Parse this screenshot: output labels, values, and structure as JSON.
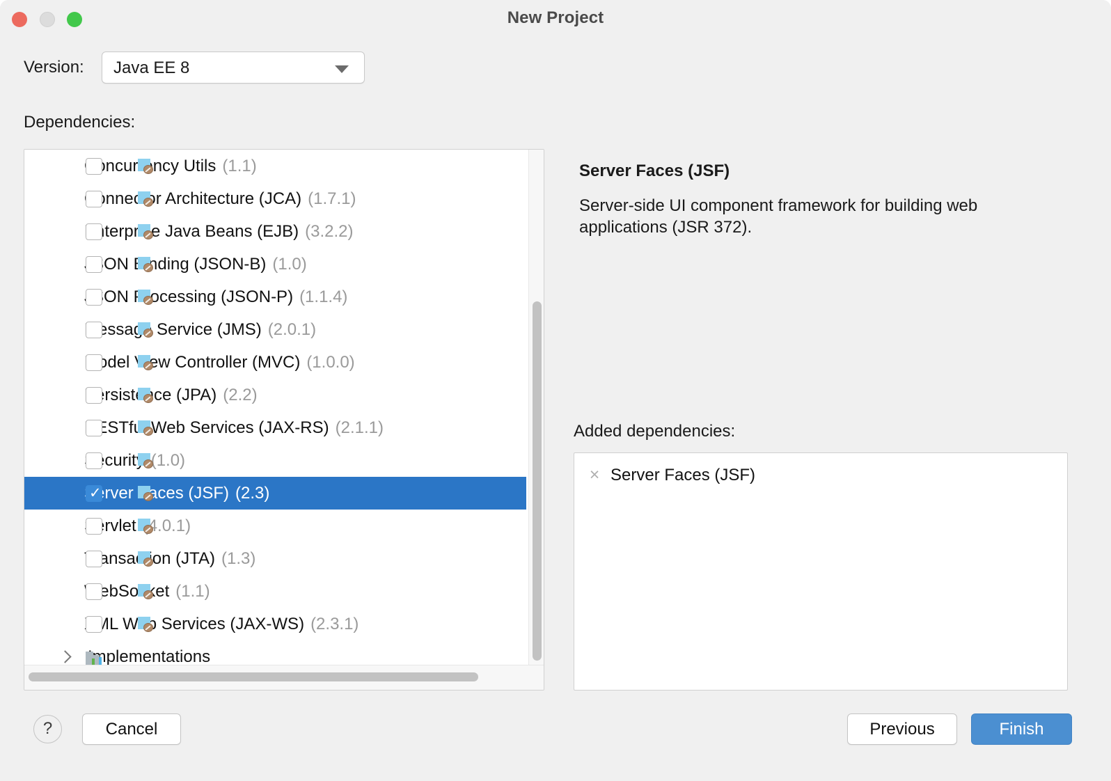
{
  "window": {
    "title": "New Project",
    "traffic_lights": [
      "close",
      "minimize",
      "maximize"
    ]
  },
  "version": {
    "label": "Version:",
    "value": "Java EE 8",
    "options": [
      "Java EE 8"
    ]
  },
  "dependencies": {
    "label": "Dependencies:",
    "items": [
      {
        "name": "Concurrency Utils",
        "version": "(1.1)",
        "checked": false,
        "selected": false
      },
      {
        "name": "Connector Architecture (JCA)",
        "version": "(1.7.1)",
        "checked": false,
        "selected": false
      },
      {
        "name": "Enterprise Java Beans (EJB)",
        "version": "(3.2.2)",
        "checked": false,
        "selected": false
      },
      {
        "name": "JSON Binding (JSON-B)",
        "version": "(1.0)",
        "checked": false,
        "selected": false
      },
      {
        "name": "JSON Processing (JSON-P)",
        "version": "(1.1.4)",
        "checked": false,
        "selected": false
      },
      {
        "name": "Message Service (JMS)",
        "version": "(2.0.1)",
        "checked": false,
        "selected": false
      },
      {
        "name": "Model View Controller (MVC)",
        "version": "(1.0.0)",
        "checked": false,
        "selected": false
      },
      {
        "name": "Persistence (JPA)",
        "version": "(2.2)",
        "checked": false,
        "selected": false
      },
      {
        "name": "RESTful Web Services (JAX-RS)",
        "version": "(2.1.1)",
        "checked": false,
        "selected": false
      },
      {
        "name": "Security",
        "version": "(1.0)",
        "checked": false,
        "selected": false
      },
      {
        "name": "Server Faces (JSF)",
        "version": "(2.3)",
        "checked": true,
        "selected": true
      },
      {
        "name": "Servlet",
        "version": "(4.0.1)",
        "checked": false,
        "selected": false
      },
      {
        "name": "Transaction (JTA)",
        "version": "(1.3)",
        "checked": false,
        "selected": false
      },
      {
        "name": "WebSocket",
        "version": "(1.1)",
        "checked": false,
        "selected": false
      },
      {
        "name": "XML Web Services (JAX-WS)",
        "version": "(2.3.1)",
        "checked": false,
        "selected": false
      }
    ],
    "group": {
      "label": "Implementations",
      "expanded": false
    }
  },
  "detail": {
    "title": "Server Faces (JSF)",
    "description": "Server-side UI component framework for building web applications (JSR 372)."
  },
  "added": {
    "label": "Added dependencies:",
    "items": [
      {
        "name": "Server Faces (JSF)",
        "remove": "×"
      }
    ]
  },
  "footer": {
    "help": "?",
    "cancel": "Cancel",
    "previous": "Previous",
    "finish": "Finish"
  },
  "colors": {
    "selection_blue": "#2b76c6",
    "primary_button": "#4b8fd1",
    "window_bg": "#f0f0f0",
    "java_icon_blue": "#8ed1ef",
    "version_text_gray": "#9a9a9a"
  }
}
